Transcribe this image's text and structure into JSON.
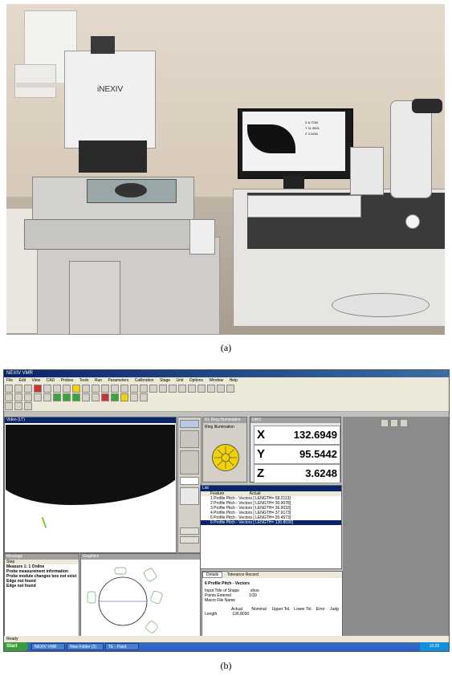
{
  "caption_a": "(a)",
  "caption_b": "(b)",
  "photo": {
    "machine_brand": "iNEXIV",
    "monitor_readout": [
      {
        "axis": "X",
        "value": "6.7250"
      },
      {
        "axis": "Y",
        "value": "11.3521"
      },
      {
        "axis": "Z",
        "value": "3.1046"
      }
    ]
  },
  "app": {
    "window_title": "NEXIV VMR",
    "menu": [
      "File",
      "Edit",
      "View",
      "CAD",
      "Probes",
      "Tools",
      "Run",
      "Parameters",
      "Calibration",
      "Stage",
      "Unit",
      "Options",
      "Window",
      "Help"
    ],
    "video_title": "Video (LT)",
    "dro_title": "DRO",
    "ring_light_title": "RL Ring Illumination",
    "rsl_label": "Ring Illumination",
    "dro": [
      {
        "axis": "X",
        "value": "132.6949"
      },
      {
        "axis": "Y",
        "value": "95.5442"
      },
      {
        "axis": "Z",
        "value": "3.6248"
      }
    ],
    "list_title": "List",
    "list_headers": [
      "Feature",
      "Actual"
    ],
    "list_rows": [
      "1 Profile Pitch - Vectors [ LENGTH=  58.2113]",
      "2 Profile Pitch - Vectors [ LENGTH=  30.9078]",
      "3 Profile Pitch - Vectors [ LENGTH=  36.9033]",
      "4 Profile Pitch - Vectors [ LENGTH=  37.9173]",
      "5 Profile Pitch - Vectors [ LENGTH=  20.4573]",
      "6 Profile Pitch - Vectors [ LENGTH= 136.8030]"
    ],
    "list_selected_index": 5,
    "messages_title": "Message",
    "messages_tab": "Step",
    "messages": [
      "Measure 1: 1 Online",
      "Probe measurement information",
      "Probe module changes box not exist",
      "Edge not found",
      "Edge not found"
    ],
    "graphics_title": "Graphics",
    "props_tabs": [
      "Details",
      "Tolerance Record"
    ],
    "props_heading": "6   Profile Pitch - Vectors",
    "props_lines": [
      "Input Title of Shape          shoe",
      "Points Entered                1/39",
      "Macro File Name"
    ],
    "props_table_headers": [
      "Actual",
      "Nominal",
      "Upper Tol.",
      "Lower Tol.",
      "Error",
      "Judg"
    ],
    "props_row_label": "Length",
    "props_row_value": "136.8030",
    "status_text": "Ready",
    "start_label": "Start",
    "tasks": [
      "NEXIV VMR",
      "New Folder (2)",
      "TE - Paint"
    ],
    "clock": "10:25"
  }
}
